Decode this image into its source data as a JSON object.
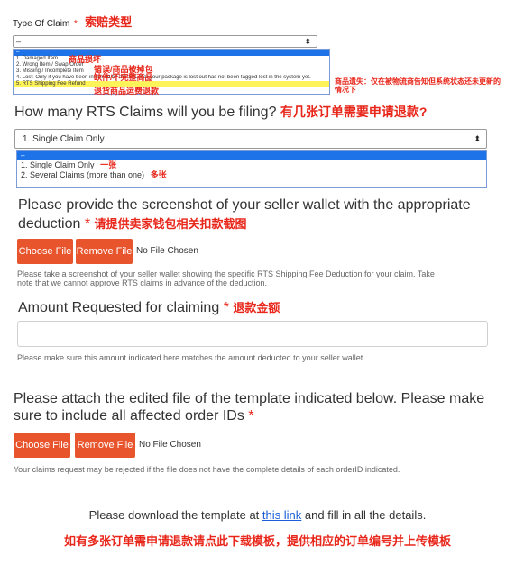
{
  "claim_type": {
    "label": "Type Of Claim",
    "required_mark": "*",
    "annotation": "索赔类型",
    "selected_value": "–",
    "options": [
      {
        "text": "–"
      },
      {
        "text": "1. Damaged Item",
        "annotation": "商品损坏"
      },
      {
        "text": "2. Wrong Item / Swap Order",
        "annotation": "错误/商品被掉包"
      },
      {
        "text": "3. Missing / Incomplete Item",
        "annotation": "缺件/不完整商品"
      },
      {
        "text": "4. Lost: Only if you have been informed by the 3PL that your package is lost out has not been tagged lost in the system yet.",
        "annotation": "商品遗失：仅在被物流商告知但系统状态还未更新的情况下"
      },
      {
        "text": "5. RTS Shipping Fee Refund",
        "annotation": "退货商品运费退款"
      }
    ]
  },
  "rts_count": {
    "question": "How many RTS Claims will you be filing?",
    "annotation": "有几张订单需要申请退款?",
    "selected_value": "1. Single Claim Only",
    "options": [
      {
        "text": "–"
      },
      {
        "text": "1. Single Claim Only",
        "annotation": "一张"
      },
      {
        "text": "2. Several Claims (more than one)",
        "annotation": "多张"
      }
    ]
  },
  "wallet": {
    "question_line1": "Please provide the screenshot of your seller wallet with the appropriate",
    "question_line2": "deduction",
    "required_mark": "*",
    "annotation": "请提供卖家钱包相关扣款截图",
    "choose_label": "Choose File",
    "remove_label": "Remove File",
    "file_status": "No File Chosen",
    "help_line1": "Please take a screenshot of your seller wallet showing the specific RTS Shipping Fee Deduction for your claim. Take",
    "help_line2": "note that we cannot approve RTS claims in advance of the deduction."
  },
  "amount": {
    "question": "Amount Requested for claiming",
    "required_mark": "*",
    "annotation": "退款金额",
    "value": "",
    "help": "Please make sure this amount indicated here matches the amount deducted to your seller wallet."
  },
  "template_upload": {
    "question_line1": "Please attach the edited file of the template indicated below. Please make",
    "question_line2": "sure to include all affected order IDs",
    "required_mark": "*",
    "choose_label": "Choose File",
    "remove_label": "Remove File",
    "file_status": "No File Chosen",
    "help": "Your claims request may be rejected if the file does not have the complete details of each orderID indicated."
  },
  "download": {
    "text_before": "Please download the template at",
    "link_text": "this link",
    "text_after": "and fill in all the details.",
    "annotation": "如有多张订单需申请退款请点此下载模板，提供相应的订单编号并上传模板"
  }
}
